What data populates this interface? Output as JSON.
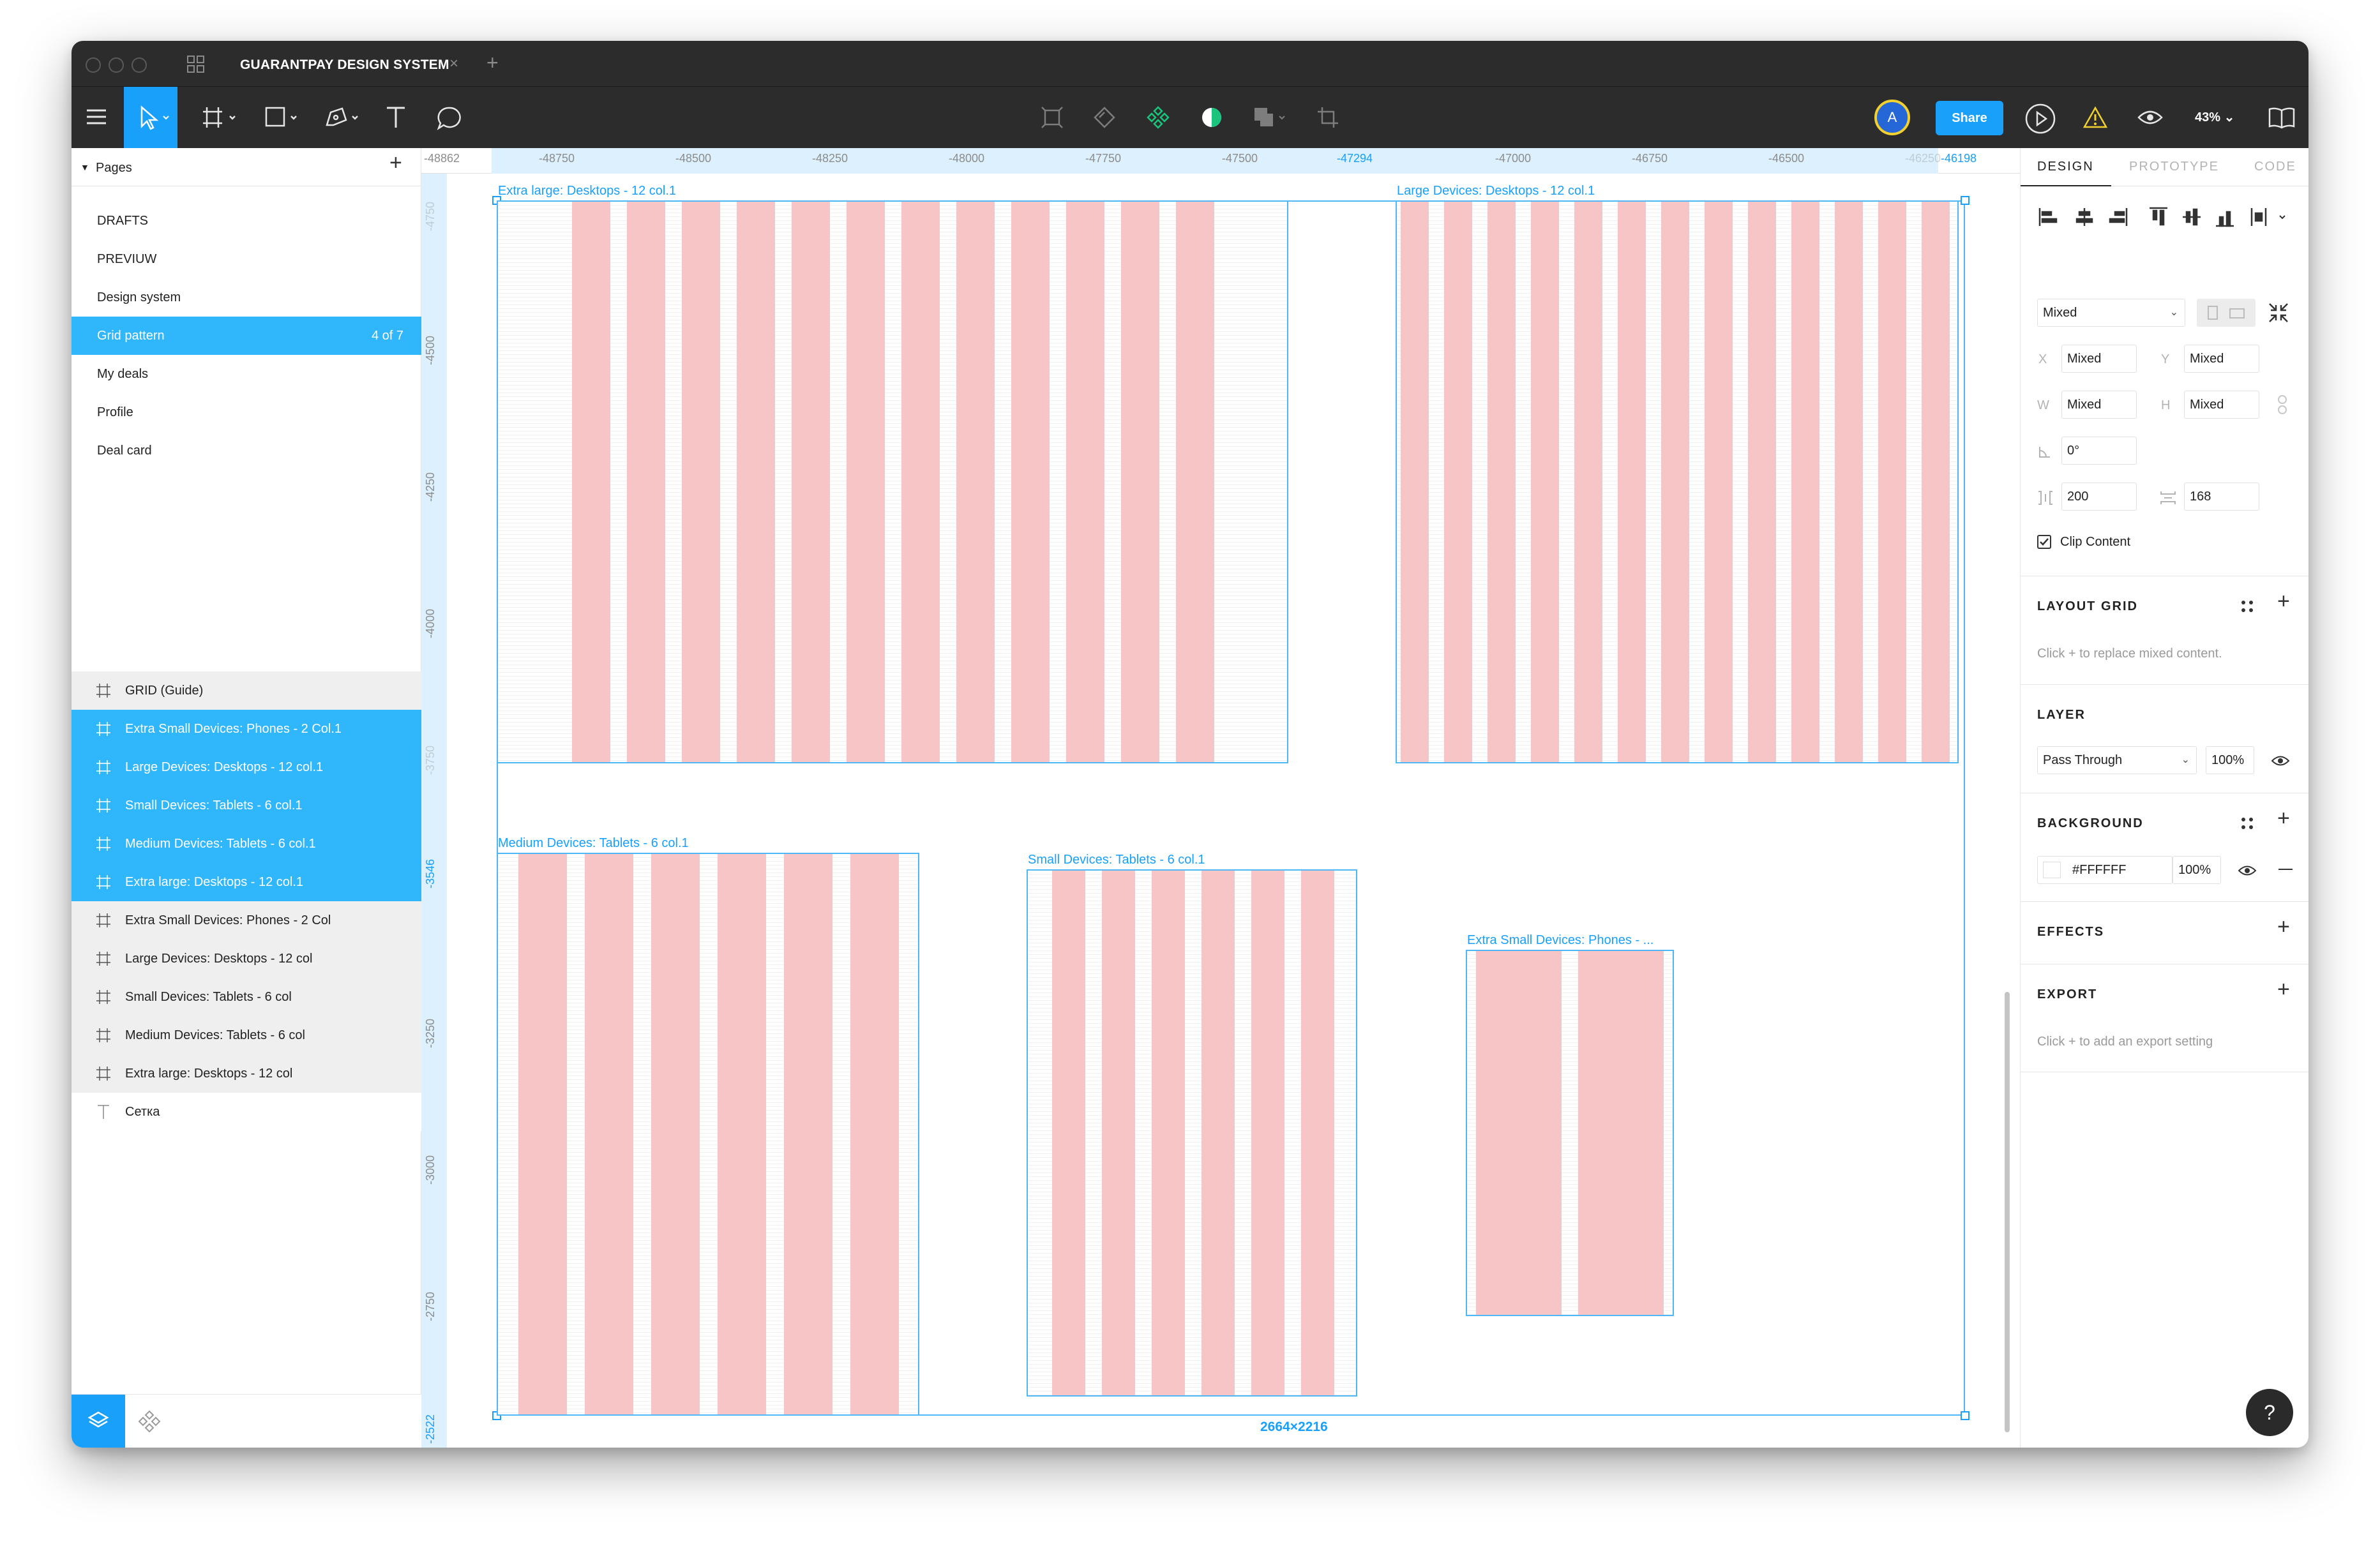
{
  "window": {
    "tab_title": "GUARANTPAY DESIGN SYSTEM",
    "tab_close": "×",
    "tab_add": "+"
  },
  "toolbar": {
    "avatar_letter": "A",
    "share_label": "Share",
    "zoom_label": "43% ⌄"
  },
  "pages": {
    "header": "Pages",
    "add": "+",
    "items": [
      {
        "label": "DRAFTS"
      },
      {
        "label": "PREVIUW"
      },
      {
        "label": "Design system"
      },
      {
        "label": "Grid pattern",
        "count": "4 of 7"
      },
      {
        "label": "My deals"
      },
      {
        "label": "Profile"
      },
      {
        "label": "Deal card"
      }
    ]
  },
  "layers": {
    "items": [
      {
        "label": "GRID (Guide)"
      },
      {
        "label": "Extra Small Devices: Phones - 2 Col.1"
      },
      {
        "label": "Large Devices: Desktops - 12 col.1"
      },
      {
        "label": "Small Devices: Tablets - 6 col.1"
      },
      {
        "label": "Medium Devices: Tablets - 6 col.1"
      },
      {
        "label": "Extra large: Desktops - 12 col.1"
      },
      {
        "label": "Extra Small Devices: Phones - 2 Col"
      },
      {
        "label": "Large Devices: Desktops - 12 col"
      },
      {
        "label": "Small Devices: Tablets - 6 col"
      },
      {
        "label": "Medium Devices: Tablets - 6 col"
      },
      {
        "label": "Extra large: Desktops - 12 col"
      },
      {
        "label": "Сетка"
      }
    ]
  },
  "rulers": {
    "top": [
      "-48862",
      "-48750",
      "-48500",
      "-48250",
      "-48000",
      "-47750",
      "-47500",
      "-47294",
      "-47000",
      "-46750",
      "-46500",
      "-46250",
      "-46198"
    ],
    "left": [
      "-4750",
      "-4500",
      "-4250",
      "-4000",
      "-3750",
      "-3546",
      "-3250",
      "-3000",
      "-2750",
      "-2522"
    ]
  },
  "canvas": {
    "frames": [
      {
        "label": "Extra large: Desktops - 12 col.1"
      },
      {
        "label": "Large Devices: Desktops - 12 col.1"
      },
      {
        "label": "Medium Devices: Tablets - 6 col.1"
      },
      {
        "label": "Small Devices: Tablets - 6 col.1"
      },
      {
        "label": "Extra Small Devices: Phones - ..."
      }
    ],
    "selection_size": "2664×2216"
  },
  "design_panel": {
    "tabs": [
      "DESIGN",
      "PROTOTYPE",
      "CODE"
    ],
    "constraint_select": "Mixed",
    "x_label": "X",
    "x_value": "Mixed",
    "y_label": "Y",
    "y_value": "Mixed",
    "w_label": "W",
    "w_value": "Mixed",
    "h_label": "H",
    "h_value": "Mixed",
    "rotation": "0°",
    "spacing_h": "200",
    "spacing_v": "168",
    "clip_content": "Clip Content",
    "layout_grid": {
      "title": "LAYOUT GRID",
      "hint": "Click + to replace mixed content."
    },
    "layer": {
      "title": "LAYER",
      "blend": "Pass Through",
      "opacity": "100%"
    },
    "background": {
      "title": "BACKGROUND",
      "color": "#FFFFFF",
      "opacity": "100%"
    },
    "effects": {
      "title": "EFFECTS"
    },
    "export": {
      "title": "EXPORT",
      "hint": "Click + to add an export setting"
    }
  },
  "help": "?",
  "colors": {
    "accent": "#18a0fb",
    "grid_column": "#f7c5c5",
    "chrome": "#2c2c2c",
    "warning": "#f2d12f"
  }
}
